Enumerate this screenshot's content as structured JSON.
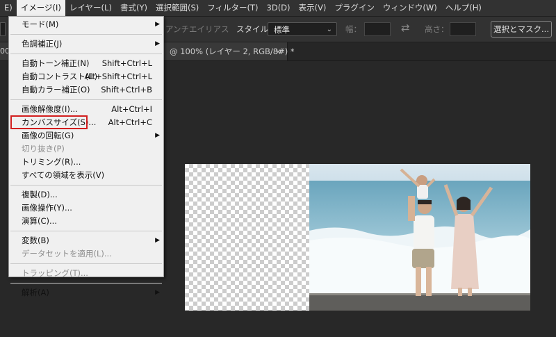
{
  "menubar": {
    "items": [
      "E)",
      "イメージ(I)",
      "レイヤー(L)",
      "書式(Y)",
      "選択範囲(S)",
      "フィルター(T)",
      "3D(D)",
      "表示(V)",
      "プラグイン",
      "ウィンドウ(W)",
      "ヘルプ(H)"
    ],
    "active_index": 1
  },
  "options": {
    "antialias": "アンチエイリアス",
    "style_label": "スタイル：",
    "style_value": "標準",
    "width_label": "幅：",
    "height_label": "高さ：",
    "select_mask": "選択とマスク..."
  },
  "tab": {
    "stub": "00",
    "title": "@ 100% (レイヤー 2, RGB/8#) *",
    "close": "×"
  },
  "menu": {
    "items": [
      {
        "label": "モード(M)",
        "submenu": true
      },
      {
        "sep": true
      },
      {
        "label": "色調補正(J)",
        "submenu": true
      },
      {
        "sep": true
      },
      {
        "label": "自動トーン補正(N)",
        "shortcut": "Shift+Ctrl+L"
      },
      {
        "label": "自動コントラスト(U)",
        "shortcut": "Alt+Shift+Ctrl+L"
      },
      {
        "label": "自動カラー補正(O)",
        "shortcut": "Shift+Ctrl+B"
      },
      {
        "sep": true
      },
      {
        "label": "画像解像度(I)...",
        "shortcut": "Alt+Ctrl+I"
      },
      {
        "label": "カンバスサイズ(S)...",
        "shortcut": "Alt+Ctrl+C",
        "highlighted": true
      },
      {
        "label": "画像の回転(G)",
        "submenu": true
      },
      {
        "label": "切り抜き(P)",
        "disabled": true
      },
      {
        "label": "トリミング(R)..."
      },
      {
        "label": "すべての領域を表示(V)"
      },
      {
        "sep": true
      },
      {
        "label": "複製(D)..."
      },
      {
        "label": "画像操作(Y)..."
      },
      {
        "label": "演算(C)..."
      },
      {
        "sep": true
      },
      {
        "label": "変数(B)",
        "submenu": true
      },
      {
        "label": "データセットを適用(L)...",
        "disabled": true
      },
      {
        "sep": true
      },
      {
        "label": "トラッピング(T)...",
        "disabled": true
      },
      {
        "sep": true
      },
      {
        "label": "解析(A)",
        "submenu": true
      }
    ]
  },
  "colors": {
    "highlight": "#d21f1f",
    "menu_bg": "#f0f0f0",
    "app_bg": "#282828"
  }
}
